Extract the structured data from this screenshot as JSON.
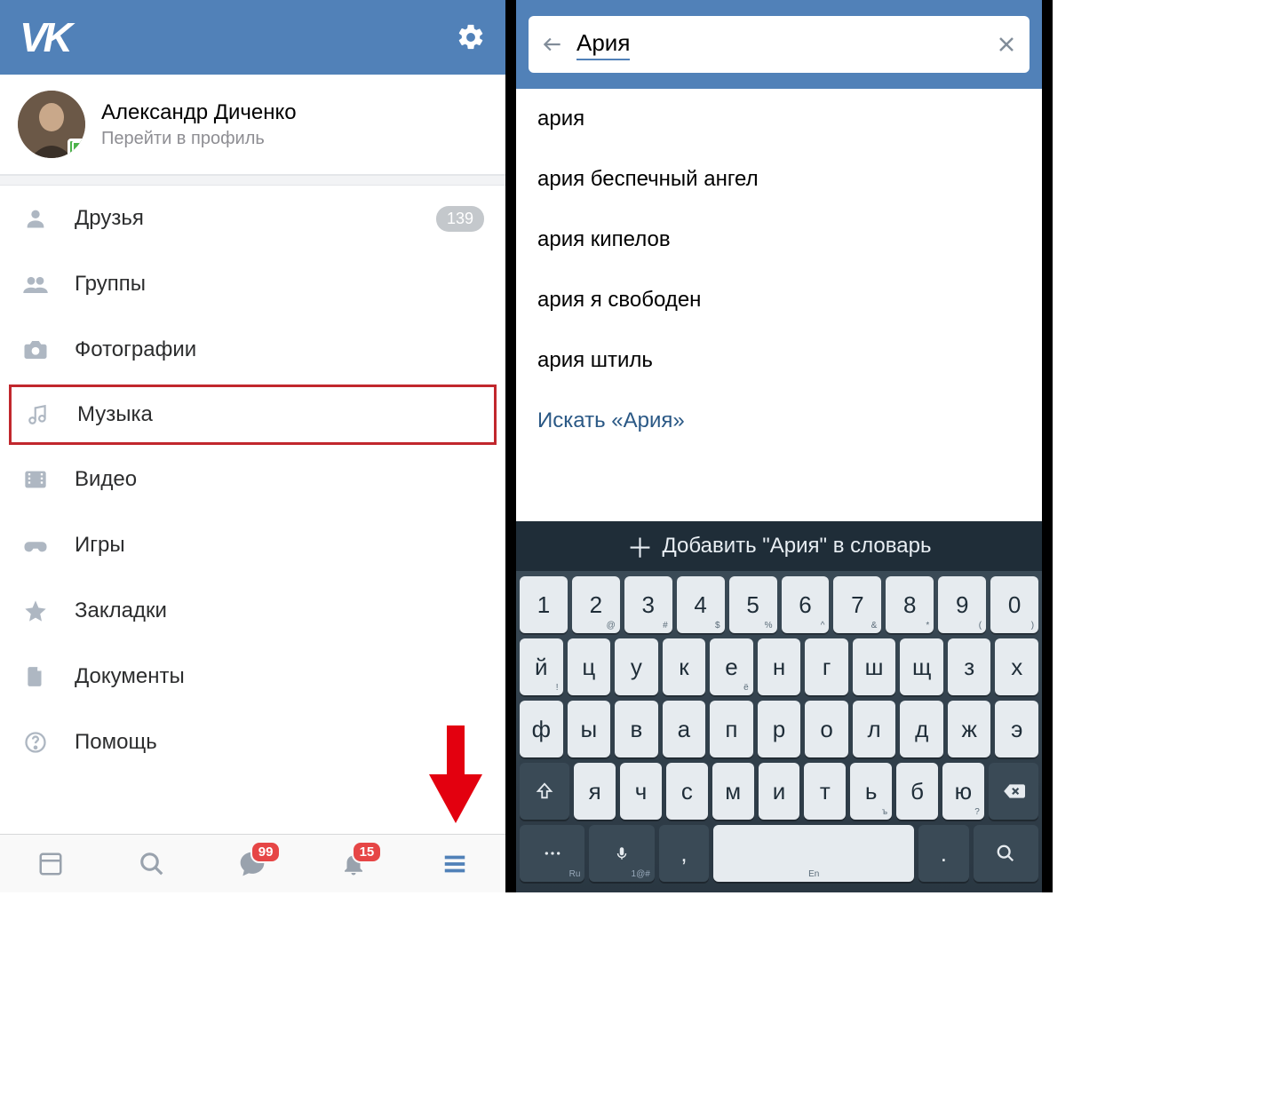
{
  "left": {
    "profile": {
      "name": "Александр Диченко",
      "subtitle": "Перейти в профиль"
    },
    "menu": [
      {
        "icon": "person",
        "label": "Друзья",
        "badge": "139"
      },
      {
        "icon": "people",
        "label": "Группы"
      },
      {
        "icon": "camera",
        "label": "Фотографии"
      },
      {
        "icon": "music",
        "label": "Музыка",
        "highlighted": true
      },
      {
        "icon": "video",
        "label": "Видео"
      },
      {
        "icon": "gamepad",
        "label": "Игры"
      },
      {
        "icon": "star",
        "label": "Закладки"
      },
      {
        "icon": "doc",
        "label": "Документы"
      },
      {
        "icon": "help",
        "label": "Помощь"
      }
    ],
    "bottom": {
      "messages_badge": "99",
      "notifications_badge": "15"
    }
  },
  "right": {
    "search_value": "Ария",
    "suggestions": [
      "ария",
      "ария беспечный ангел",
      "ария кипелов",
      "ария я свободен",
      "ария штиль"
    ],
    "search_action": "Искать «Ария»",
    "keyboard": {
      "suggestion_bar": "Добавить \"Ария\" в словарь",
      "row1": [
        {
          "k": "1",
          "s": ""
        },
        {
          "k": "2",
          "s": "@"
        },
        {
          "k": "3",
          "s": "#"
        },
        {
          "k": "4",
          "s": "$"
        },
        {
          "k": "5",
          "s": "%"
        },
        {
          "k": "6",
          "s": "^"
        },
        {
          "k": "7",
          "s": "&"
        },
        {
          "k": "8",
          "s": "*"
        },
        {
          "k": "9",
          "s": "("
        },
        {
          "k": "0",
          "s": ")"
        }
      ],
      "row2": [
        {
          "k": "й",
          "s": "!"
        },
        {
          "k": "ц",
          "s": ""
        },
        {
          "k": "у",
          "s": ""
        },
        {
          "k": "к",
          "s": ""
        },
        {
          "k": "е",
          "s": "ё"
        },
        {
          "k": "н",
          "s": ""
        },
        {
          "k": "г",
          "s": ""
        },
        {
          "k": "ш",
          "s": ""
        },
        {
          "k": "щ",
          "s": ""
        },
        {
          "k": "з",
          "s": ""
        },
        {
          "k": "х",
          "s": ""
        }
      ],
      "row3": [
        {
          "k": "ф",
          "s": ""
        },
        {
          "k": "ы",
          "s": ""
        },
        {
          "k": "в",
          "s": ""
        },
        {
          "k": "а",
          "s": ""
        },
        {
          "k": "п",
          "s": ""
        },
        {
          "k": "р",
          "s": ""
        },
        {
          "k": "о",
          "s": ""
        },
        {
          "k": "л",
          "s": ""
        },
        {
          "k": "д",
          "s": ""
        },
        {
          "k": "ж",
          "s": ""
        },
        {
          "k": "э",
          "s": ""
        }
      ],
      "row4": [
        {
          "k": "я",
          "s": ""
        },
        {
          "k": "ч",
          "s": ""
        },
        {
          "k": "с",
          "s": ""
        },
        {
          "k": "м",
          "s": ""
        },
        {
          "k": "и",
          "s": ""
        },
        {
          "k": "т",
          "s": ""
        },
        {
          "k": "ь",
          "s": "ъ"
        },
        {
          "k": "б",
          "s": ""
        },
        {
          "k": "ю",
          "s": "?"
        }
      ],
      "row5": {
        "lang": "Ru",
        "sym": "1@#",
        "comma": ",",
        "space": "En",
        "dot": "."
      }
    }
  }
}
